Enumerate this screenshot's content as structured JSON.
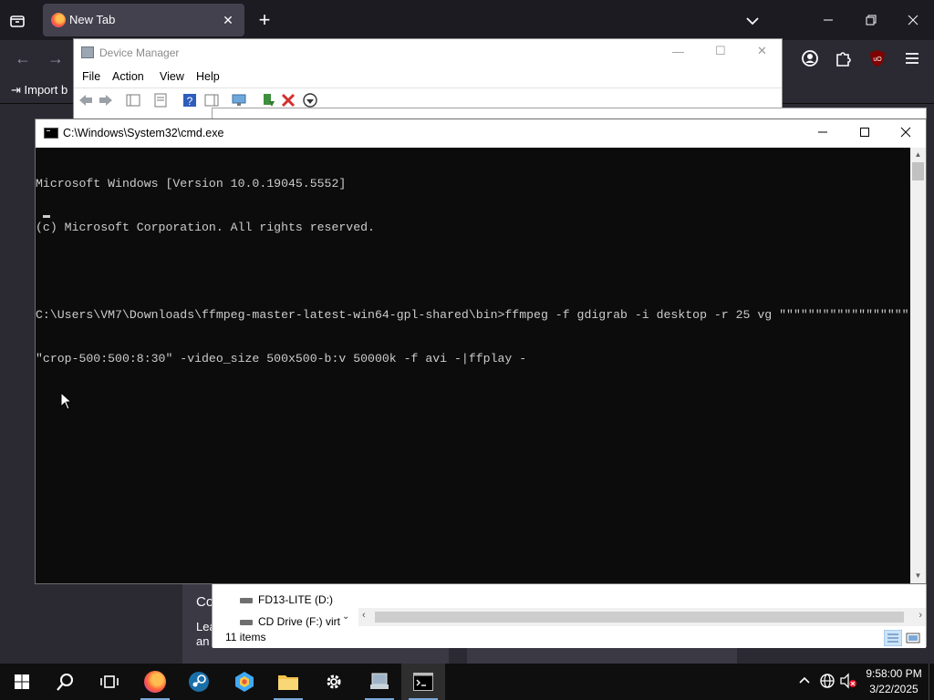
{
  "firefox": {
    "tab_title": "New Tab",
    "tab_close": "✕",
    "new_tab": "+",
    "bookmarks_import_label": "Import b"
  },
  "device_manager": {
    "title": "Device Manager",
    "menu": [
      "File",
      "Action",
      "View",
      "Help"
    ]
  },
  "explorer": {
    "drives": [
      "FD13-LITE (D:)",
      "CD Drive (F:) virt"
    ],
    "status_items": "11 items",
    "bg_text_1": "Co",
    "bg_text_2": "Lea",
    "bg_text_3": "an"
  },
  "cmd": {
    "title": "C:\\Windows\\System32\\cmd.exe",
    "lines": [
      "Microsoft Windows [Version 10.0.19045.5552]",
      "(c) Microsoft Corporation. All rights reserved.",
      "",
      "C:\\Users\\VM7\\Downloads\\ffmpeg-master-latest-win64-gpl-shared\\bin>ffmpeg -f gdigrab -i desktop -r 25 vg \"\"\"\"\"\"\"\"\"\"\"\"\"\"\"\"\"\"\"",
      "\"crop-500:500:8:30\" -video_size 500x500-b:v 50000k -f avi -|ffplay -"
    ]
  },
  "taskbar": {
    "time": "9:58:00 PM",
    "date": "3/22/2025"
  },
  "colors": {
    "cmd_bg": "#0c0c0c",
    "cmd_text": "#cccccc",
    "firefox_bg": "#1c1b22",
    "taskbar_bg": "#0f0f0f"
  }
}
